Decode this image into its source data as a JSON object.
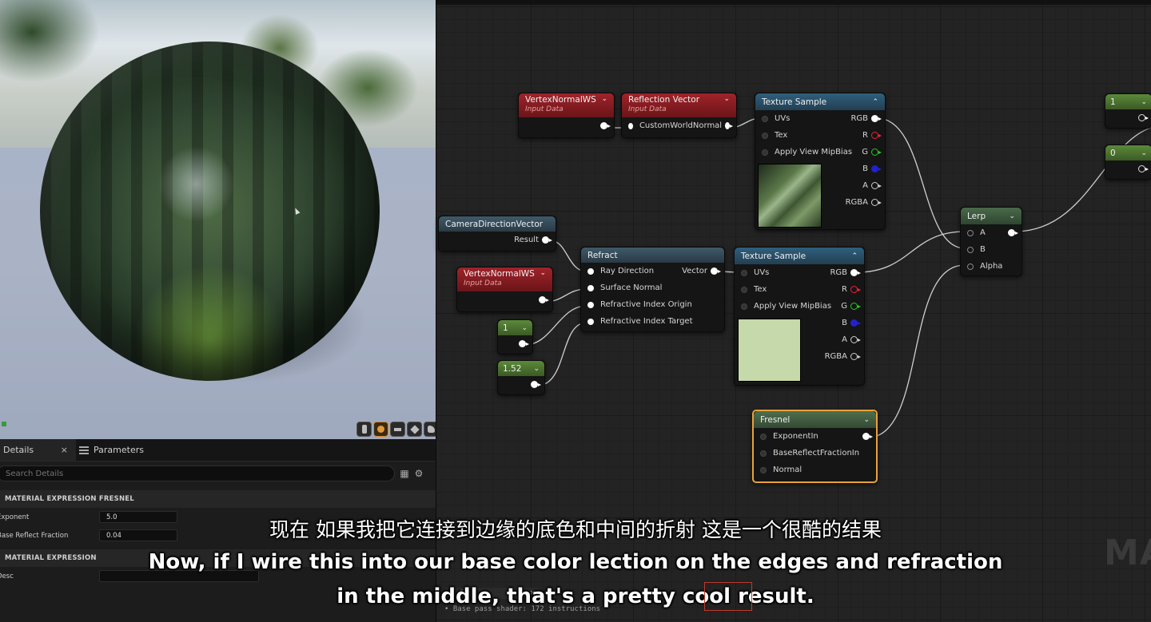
{
  "viewport": {
    "preview_shapes": [
      "cylinder-icon",
      "sphere-icon",
      "plane-icon",
      "cube-icon",
      "teapot-icon"
    ],
    "active_shape": "sphere-icon"
  },
  "details": {
    "tabs": [
      {
        "label": "Details",
        "icon": "details-icon",
        "close": "×"
      },
      {
        "label": "Parameters",
        "icon": "parameters-icon"
      }
    ],
    "search_placeholder": "Search Details",
    "sections": [
      {
        "title": "MATERIAL EXPRESSION FRESNEL",
        "props": [
          {
            "name": "Exponent",
            "value": "5.0"
          },
          {
            "name": "Base Reflect Fraction",
            "value": "0.04"
          }
        ]
      },
      {
        "title": "MATERIAL EXPRESSION",
        "props": [
          {
            "name": "Desc",
            "value": ""
          }
        ]
      }
    ]
  },
  "graph": {
    "nodes": {
      "vertex_normal_1": {
        "title": "VertexNormalWS",
        "subtitle": "Input Data"
      },
      "reflection_vector": {
        "title": "Reflection Vector",
        "subtitle": "Input Data",
        "pin": "CustomWorldNormal"
      },
      "texture_sample_1": {
        "title": "Texture Sample",
        "inputs": [
          "UVs",
          "Tex",
          "Apply View MipBias"
        ],
        "outputs": [
          "RGB",
          "R",
          "G",
          "B",
          "A",
          "RGBA"
        ]
      },
      "camera_direction": {
        "title": "CameraDirectionVector",
        "output": "Result"
      },
      "vertex_normal_2": {
        "title": "VertexNormalWS",
        "subtitle": "Input Data"
      },
      "refract": {
        "title": "Refract",
        "inputs": [
          "Ray Direction",
          "Surface Normal",
          "Refractive Index Origin",
          "Refractive Index Target"
        ],
        "output": "Vector"
      },
      "const_1": {
        "title": "1"
      },
      "const_152": {
        "title": "1.52"
      },
      "texture_sample_2": {
        "title": "Texture Sample",
        "inputs": [
          "UVs",
          "Tex",
          "Apply View MipBias"
        ],
        "outputs": [
          "RGB",
          "R",
          "G",
          "B",
          "A",
          "RGBA"
        ]
      },
      "lerp": {
        "title": "Lerp",
        "inputs": [
          "A",
          "B",
          "Alpha"
        ]
      },
      "fresnel": {
        "title": "Fresnel",
        "inputs": [
          "ExponentIn",
          "BaseReflectFractionIn",
          "Normal"
        ]
      },
      "const_top_1": {
        "title": "1"
      },
      "const_top_0": {
        "title": "0"
      }
    },
    "watermark": "MA",
    "stats": {
      "label": "St",
      "line": "Base pass shader: 172 instructions"
    }
  },
  "subtitles": {
    "zh": "现在 如果我把它连接到边缘的底色和中间的折射 这是一个很酷的结果",
    "en_line1": "Now, if I wire this into our base color lection on the edges and refraction",
    "en_line2": "in the middle, that's a pretty cool result."
  },
  "colors": {
    "input_node_header": "#a0232a",
    "texture_node_header": "#2f5f7d",
    "constant_node_header": "#5b8a3a",
    "selection_outline": "#e8a23a"
  }
}
